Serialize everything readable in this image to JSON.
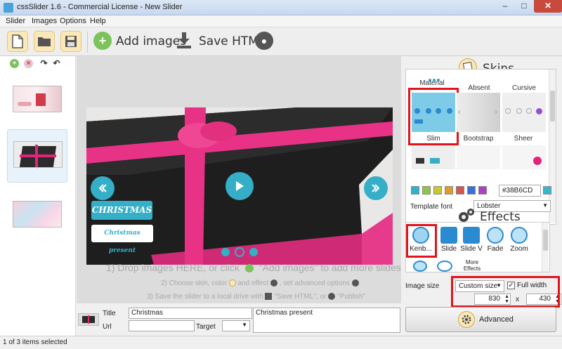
{
  "window": {
    "title": "cssSlider 1.6 - Commercial License - New Slider"
  },
  "menu": [
    "Slider",
    "Images",
    "Options",
    "Help"
  ],
  "toolbar": {
    "add_images": "Add images",
    "save_html": "Save HTML"
  },
  "slide": {
    "caption_title": "CHRISTMAS",
    "caption_sub": "Christmas present"
  },
  "hints": {
    "line1": "1) Drop images HERE, or click",
    "line1b": "\"Add images\" to add more slides",
    "line2a": "2) Choose skin, color",
    "line2b": "and effect",
    "line2c": ", set advanced options",
    "line3a": "3) Save the slider to a local drive with",
    "line3b": "\"Save HTML\", or",
    "line3c": "\"Publish\""
  },
  "fields": {
    "title_label": "Title",
    "title_value": "Christmas",
    "url_label": "Url",
    "url_value": "",
    "target_label": "Target",
    "target_value": "",
    "description_value": "Christmas present"
  },
  "status": {
    "text": "1 of 3 items selected"
  },
  "skins": {
    "heading": "Skins",
    "top_labels": [
      "Material",
      "Absent",
      "Cursive"
    ],
    "mid_labels": [
      "Slim",
      "Bootstrap",
      "Sheer"
    ],
    "selected": "Slim",
    "color_value": "#38B6CD",
    "swatches": [
      "#2eb2cc",
      "#8dc63f",
      "#c9c92e",
      "#e39a2d",
      "#d9534f",
      "#3a6fd8",
      "#b03cc8"
    ],
    "font_label": "Template font",
    "font_value": "Lobster"
  },
  "effects": {
    "heading": "Effects",
    "items": [
      "Kenb...",
      "Slide",
      "Slide V",
      "Fade",
      "Zoom"
    ],
    "more_label": "More Effects",
    "selected": "Kenb..."
  },
  "image_size": {
    "label": "Image size",
    "mode": "Custom size",
    "full_width_label": "Full width",
    "full_width": true,
    "width": "830",
    "times": "x",
    "height": "430"
  },
  "advanced": {
    "label": "Advanced"
  },
  "colors": {
    "accent": "#35aec7",
    "highlight": "#e2141b",
    "toolbar_btn": "#fbe8b8"
  }
}
